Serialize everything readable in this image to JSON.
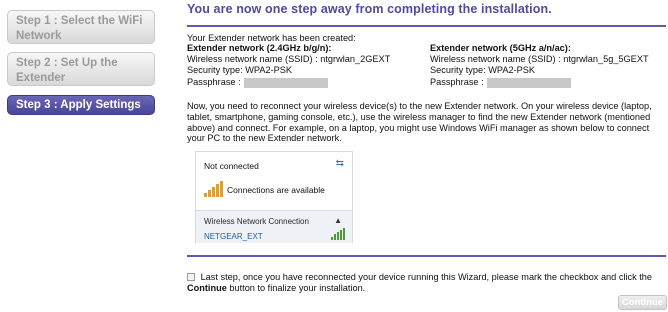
{
  "sidebar": {
    "steps": [
      {
        "label": "Step 1 : Select the WiFi Network",
        "active": false
      },
      {
        "label": "Step 2 : Set Up the Extender",
        "active": false
      },
      {
        "label": "Step 3 : Apply Settings",
        "active": true
      }
    ]
  },
  "main": {
    "heading": "You are now one step away from completing the installation.",
    "created_text": "Your Extender network has been created:",
    "network_24": {
      "title": "Extender network (2.4GHz b/g/n):",
      "ssid_label": "Wireless network name (SSID) :",
      "ssid": "ntgrwlan_2GEXT",
      "security_label": "Security type:",
      "security": "WPA2-PSK",
      "passphrase_label": "Passphrase :"
    },
    "network_5": {
      "title": "Extender network (5GHz a/n/ac):",
      "ssid_label": "Wireless network name (SSID) :",
      "ssid": "ntgrwlan_5g_5GEXT",
      "security_label": "Security type:",
      "security": "WPA2-PSK",
      "passphrase_label": "Passphrase :"
    },
    "instructions": "Now, you need to reconnect your wireless device(s) to the new Extender network. On your wireless device (laptop, tablet, smartphone, gaming console, etc.), use the wireless manager to find the new Extender network (mentioned above) and connect. For example, on a laptop, you might use Windows WiFi manager as shown below to connect your PC to the new Extender network.",
    "wifi_popup": {
      "status": "Not connected",
      "available": "Connections are available",
      "section": "Wireless Network Connection",
      "network": "NETGEAR_EXT"
    },
    "last_step_text_before": "Last step, once you have reconnected your device running this Wizard, please mark the checkbox and click the",
    "last_step_bold": "Continue",
    "last_step_text_after": "button to finalize your installation.",
    "continue_label": "Continue"
  }
}
